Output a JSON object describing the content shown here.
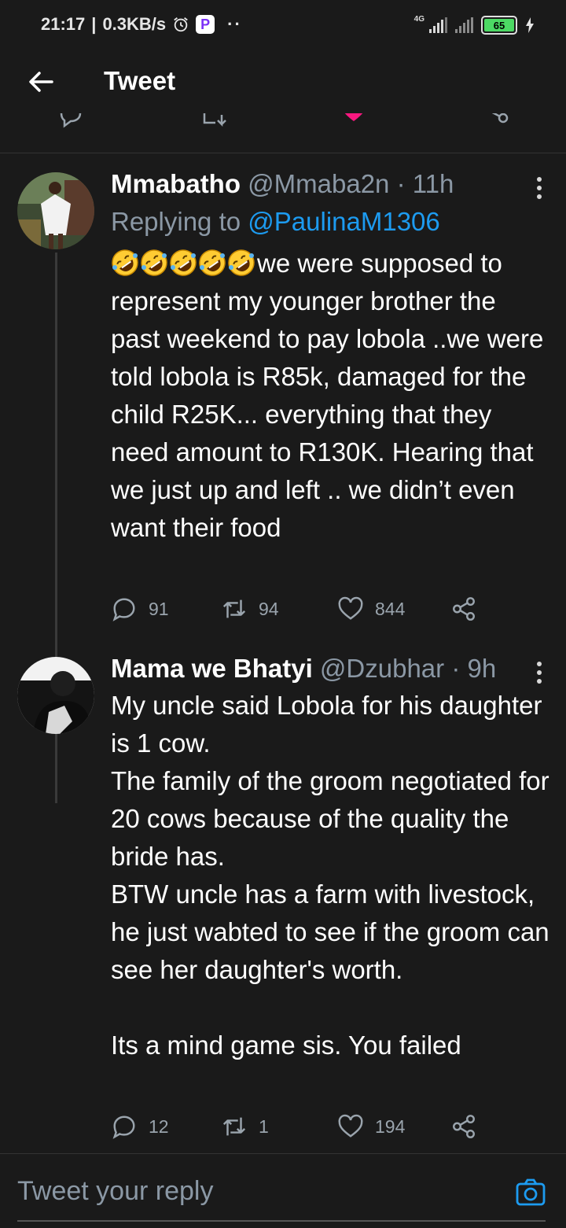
{
  "status_bar": {
    "time": "21:17",
    "speed": "0.3KB/s",
    "app_badge": "P",
    "network": "4G",
    "battery": "65"
  },
  "header": {
    "title": "Tweet"
  },
  "tweets": [
    {
      "name": "Mmabatho",
      "handle": "@Mmaba2n",
      "time": "11h",
      "replying_prefix": "Replying to",
      "replying_to": "@PaulinaM1306",
      "emoji_count": 5,
      "text": "we were supposed to represent my younger brother the past weekend to pay lobola ..we were told lobola is R85k, damaged for the child R25K... everything that they need amount to R130K. Hearing that we just up and left .. we didn’t even want their food",
      "replies": "91",
      "retweets": "94",
      "likes": "844"
    },
    {
      "name": "Mama we Bhatyi",
      "handle": "@Dzubhar",
      "time": "9h",
      "text_lines": [
        "My uncle said Lobola for his daughter is 1 cow.",
        "The family of the groom negotiated for 20 cows because of the quality the bride has.",
        "BTW uncle has a farm with livestock, he just wabted to see if the groom can see her daughter's worth.",
        "",
        "Its a mind game sis. You failed"
      ],
      "replies": "12",
      "retweets": "1",
      "likes": "194"
    }
  ],
  "reply_bar": {
    "placeholder": "Tweet your reply"
  },
  "colors": {
    "background": "#1a1a1a",
    "link": "#1d9bf0",
    "muted": "#8b98a5",
    "like_pink": "#f91880"
  }
}
